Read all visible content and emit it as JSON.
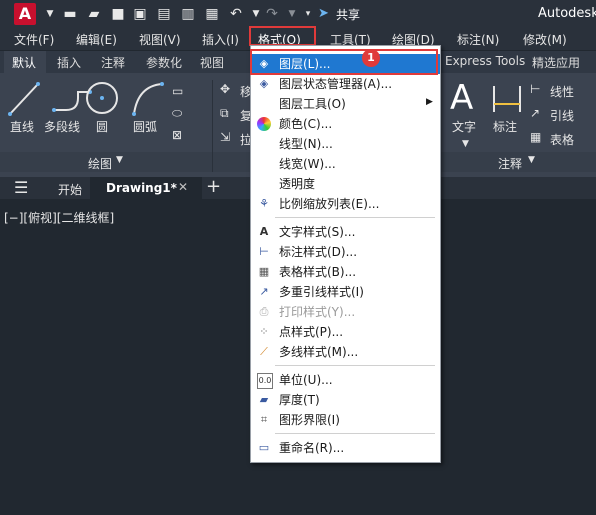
{
  "titlebar": {
    "logo_letter": "A",
    "share_label": "共享",
    "app_title": "Autodesk"
  },
  "menubar": {
    "items": [
      "文件(F)",
      "编辑(E)",
      "视图(V)",
      "插入(I)",
      "格式(O)",
      "工具(T)",
      "绘图(D)",
      "标注(N)",
      "修改(M)"
    ]
  },
  "ribbon_tabs": {
    "items": [
      "默认",
      "插入",
      "注释",
      "参数化",
      "视图",
      "Express Tools",
      "精选应用"
    ]
  },
  "ribbon": {
    "draw_tools": [
      "直线",
      "多段线",
      "圆",
      "圆弧"
    ],
    "draw_panel_label": "绘图",
    "modify_partial": [
      "移",
      "复",
      "拉"
    ],
    "annotation_tools": [
      "文字",
      "标注"
    ],
    "annotation_side": [
      "线性",
      "引线",
      "表格"
    ],
    "annotation_panel_label": "注释"
  },
  "file_tabs": {
    "start": "开始",
    "drawing": "Drawing1*"
  },
  "viewport_label": "[−][俯视][二维线框]",
  "format_menu": {
    "items": [
      {
        "label": "图层(L)...",
        "icon": "layer-icon",
        "highlighted": true
      },
      {
        "label": "图层状态管理器(A)...",
        "icon": "layer-state-icon"
      },
      {
        "label": "图层工具(O)",
        "icon": "",
        "submenu": true
      },
      {
        "label": "颜色(C)...",
        "icon": "color-wheel-icon"
      },
      {
        "label": "线型(N)...",
        "icon": ""
      },
      {
        "label": "线宽(W)...",
        "icon": ""
      },
      {
        "label": "透明度",
        "icon": ""
      },
      {
        "label": "比例缩放列表(E)...",
        "icon": "scale-list-icon"
      },
      {
        "label": "文字样式(S)...",
        "icon": "text-style-icon"
      },
      {
        "label": "标注样式(D)...",
        "icon": "dim-style-icon"
      },
      {
        "label": "表格样式(B)...",
        "icon": "table-style-icon"
      },
      {
        "label": "多重引线样式(I)",
        "icon": "mleader-style-icon"
      },
      {
        "label": "打印样式(Y)...",
        "icon": "plot-style-icon",
        "disabled": true
      },
      {
        "label": "点样式(P)...",
        "icon": "point-style-icon"
      },
      {
        "label": "多线样式(M)...",
        "icon": "mline-style-icon"
      },
      {
        "label": "单位(U)...",
        "icon": "units-icon"
      },
      {
        "label": "厚度(T)",
        "icon": "thickness-icon"
      },
      {
        "label": "图形界限(I)",
        "icon": "limits-icon"
      },
      {
        "label": "重命名(R)...",
        "icon": "rename-icon"
      }
    ]
  },
  "annotation_badge": "1"
}
